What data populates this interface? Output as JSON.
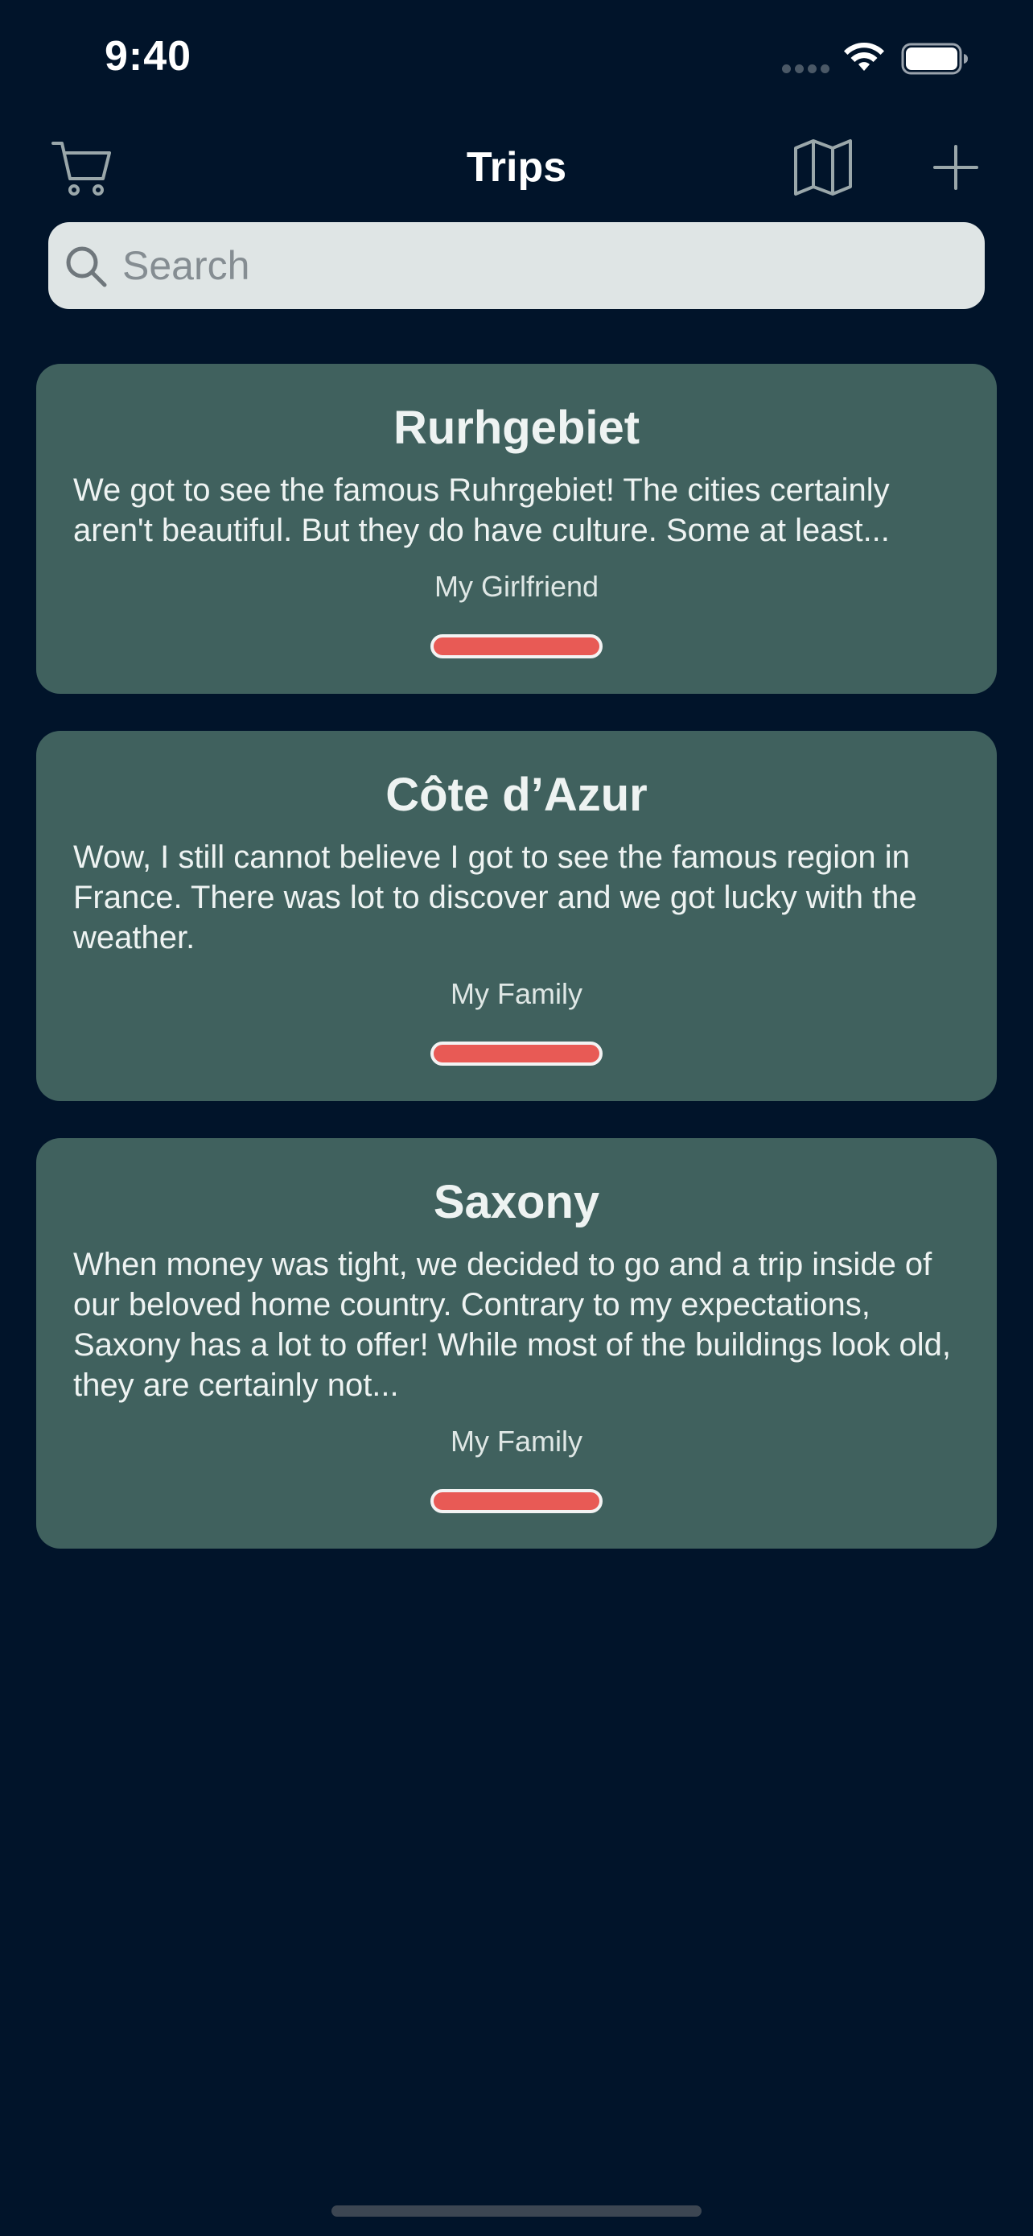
{
  "status_bar": {
    "time": "9:40"
  },
  "nav": {
    "title": "Trips",
    "icons": {
      "left": "cart-icon",
      "right_1": "map-icon",
      "right_2": "plus-icon"
    }
  },
  "search": {
    "placeholder": "Search",
    "value": ""
  },
  "trips": [
    {
      "title": "Rurhgebiet",
      "description": "We got to see the famous Ruhrgebiet! The cities certainly aren't beautiful. But they do have culture. Some at least...",
      "companion": "My Girlfriend"
    },
    {
      "title": "Côte d’Azur",
      "description": "Wow, I still cannot believe I got to see the famous region in France. There was lot to discover and we got lucky with the weather.",
      "companion": "My Family"
    },
    {
      "title": "Saxony",
      "description": "When money was tight, we decided to go and a trip inside of our beloved home country. Contrary to my expectations, Saxony has a lot to offer! While most of the buildings look old, they are certainly not...",
      "companion": "My Family"
    }
  ],
  "colors": {
    "background": "#01142a",
    "card": "#40615e",
    "accent_bar": "#e85a55",
    "search_field": "#dfe5e5"
  }
}
